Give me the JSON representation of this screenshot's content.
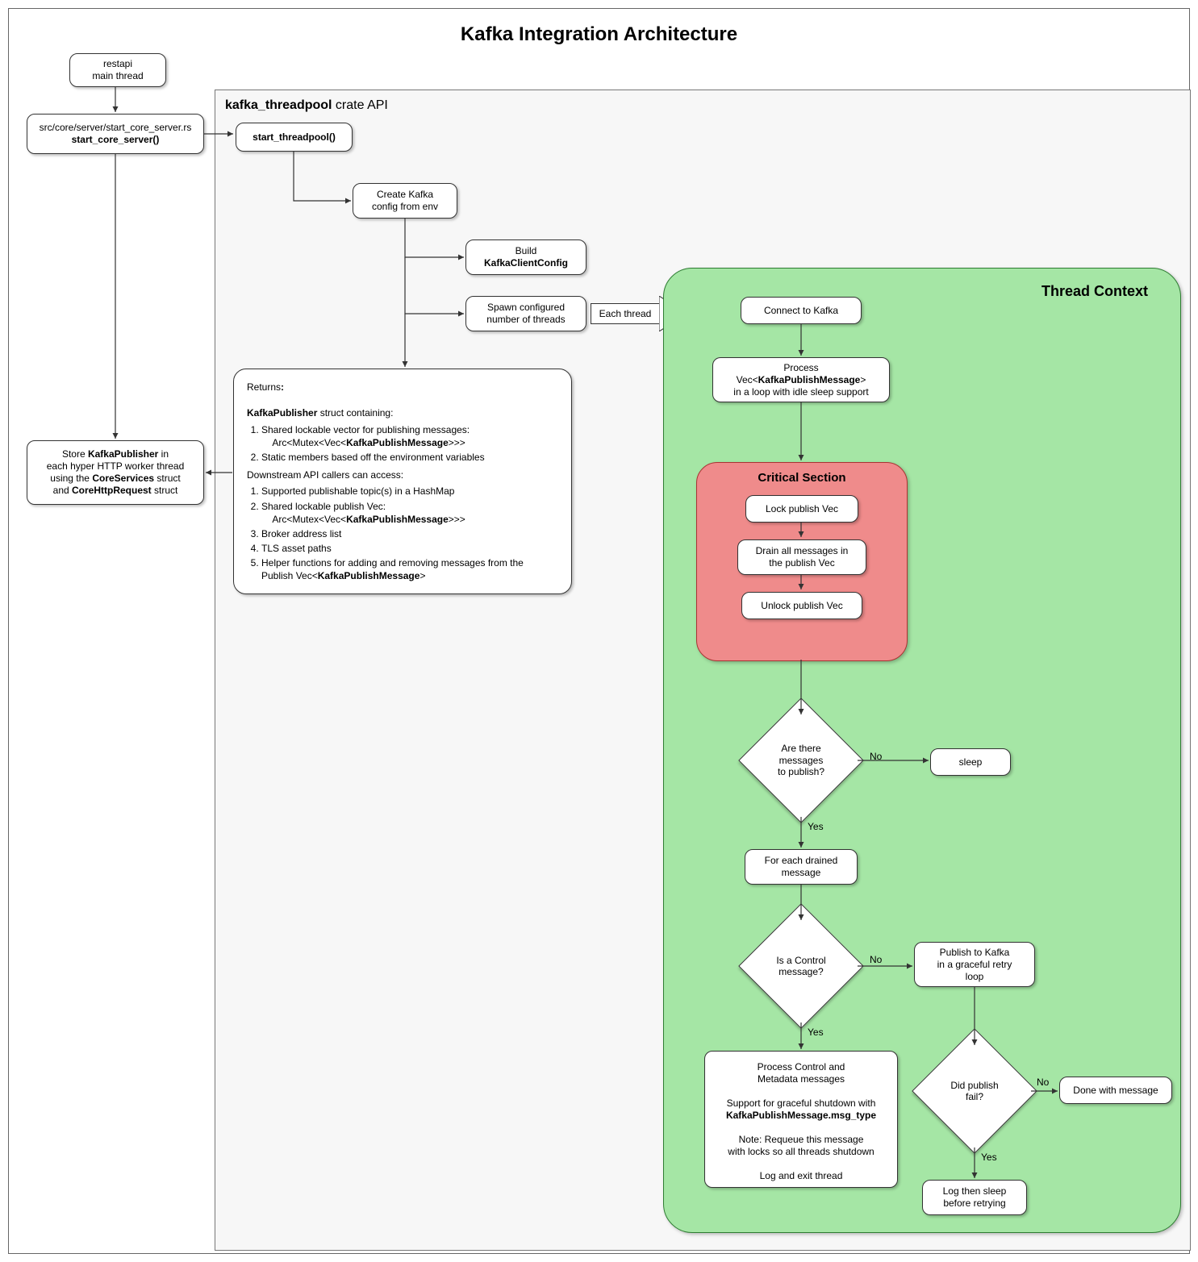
{
  "title": "Kafka Integration Architecture",
  "api_frame": {
    "title_bold": "kafka_threadpool",
    "title_rest": " crate API"
  },
  "left": {
    "restapi_l1": "restapi",
    "restapi_l2": "main thread",
    "start_core_path": "src/core/server/start_core_server.rs",
    "start_core_fn": "start_core_server()",
    "store_l1": "Store ",
    "store_kp": "KafkaPublisher",
    "store_l1b": " in",
    "store_l2": "each hyper HTTP worker thread",
    "store_l3a": "using the ",
    "store_core_services": "CoreServices",
    "store_l3b": " struct",
    "store_l4a": "and ",
    "store_core_http": "CoreHttpRequest",
    "store_l4b": " struct"
  },
  "api": {
    "start_threadpool": "start_threadpool()",
    "create_cfg_l1": "Create Kafka",
    "create_cfg_l2": "config from env",
    "build_l1": "Build",
    "build_l2": "KafkaClientConfig",
    "spawn_l1": "Spawn configured",
    "spawn_l2": "number of threads",
    "each_thread": "Each thread",
    "returns_label": "Returns",
    "returns_kp": "KafkaPublisher",
    "returns_kp_after": " struct containing:",
    "ret_li1_a": "Shared lockable vector for publishing messages:",
    "ret_li1_b": "Arc<Mutex<Vec<",
    "ret_li1_kpm": "KafkaPublishMessage",
    "ret_li1_c": ">>>",
    "ret_li2": "Static members based off the environment variables",
    "down_label": "Downstream API callers can access:",
    "d_li1": "Supported publishable topic(s) in a HashMap",
    "d_li2_a": "Shared lockable publish Vec:",
    "d_li2_b": "Arc<Mutex<Vec<",
    "d_li2_kpm": "KafkaPublishMessage",
    "d_li2_c": ">>>",
    "d_li3": "Broker address list",
    "d_li4": "TLS asset paths",
    "d_li5_a": "Helper functions for adding and removing messages from the",
    "d_li5_b": "Publish Vec<",
    "d_li5_kpm": "KafkaPublishMessage",
    "d_li5_c": ">"
  },
  "thread": {
    "title": "Thread Context",
    "connect": "Connect to Kafka",
    "process_l1": "Process",
    "process_l2a": "Vec<",
    "process_l2_kpm": "KafkaPublishMessage",
    "process_l2b": ">",
    "process_l3": "in a loop with idle sleep support",
    "critical_title": "Critical Section",
    "lock": "Lock publish Vec",
    "drain_l1": "Drain all messages in",
    "drain_l2": "the publish Vec",
    "unlock": "Unlock publish Vec",
    "q_messages_l1": "Are there",
    "q_messages_l2": "messages",
    "q_messages_l3": "to publish?",
    "sleep": "sleep",
    "foreach_l1": "For each drained",
    "foreach_l2": "message",
    "q_control_l1": "Is a Control",
    "q_control_l2": "message?",
    "publish_l1": "Publish to Kafka",
    "publish_l2": "in a graceful retry",
    "publish_l3": "loop",
    "q_fail_l1": "Did publish",
    "q_fail_l2": "fail?",
    "done": "Done with message",
    "log_retry_l1": "Log then sleep",
    "log_retry_l2": "before retrying",
    "proc_l1": "Process Control and",
    "proc_l2": "Metadata messages",
    "proc_l3": "Support for graceful shutdown with",
    "proc_kpm_mt": "KafkaPublishMessage.msg_type",
    "proc_l5": "Note: Requeue this message",
    "proc_l6": "with locks so all threads shutdown",
    "proc_l7": "Log and exit thread"
  },
  "labels": {
    "yes": "Yes",
    "no": "No"
  }
}
